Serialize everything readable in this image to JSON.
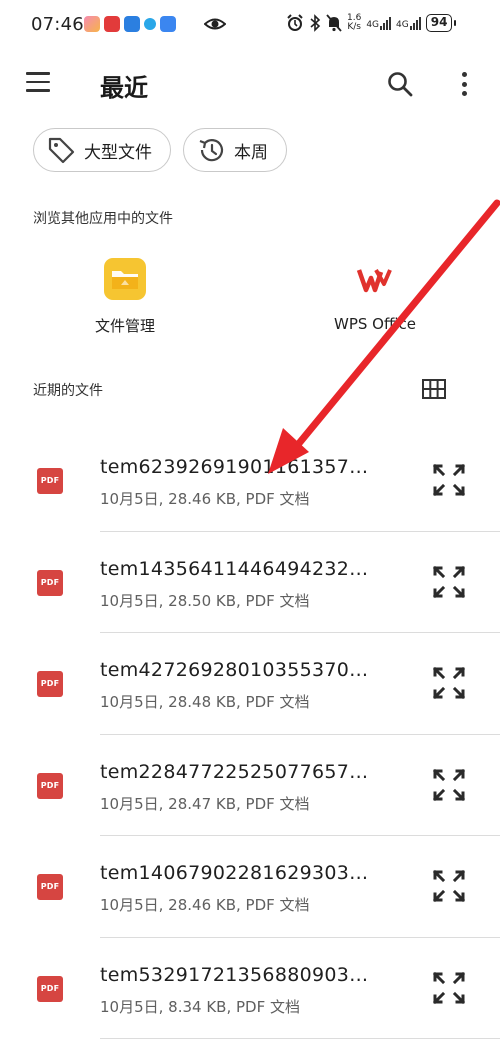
{
  "status_bar": {
    "time": "07:46",
    "net_speed_value": "1.6",
    "net_speed_unit": "K/s",
    "network_1": "4G",
    "network_2": "4G",
    "battery": "94"
  },
  "app_bar": {
    "title": "最近",
    "menu_icon": "hamburger-menu-icon",
    "search_icon": "search-icon",
    "more_icon": "more-vert-icon"
  },
  "chips": [
    {
      "label": "大型文件",
      "icon": "tag-icon"
    },
    {
      "label": "本周",
      "icon": "history-icon"
    }
  ],
  "other_apps": {
    "heading": "浏览其他应用中的文件",
    "items": [
      {
        "label": "文件管理",
        "icon": "folder-app-icon"
      },
      {
        "label": "WPS Office",
        "icon": "wps-office-icon"
      }
    ]
  },
  "recent_files": {
    "heading": "近期的文件",
    "view_toggle_icon": "grid-view-icon",
    "file_type_badge": "PDF",
    "items": [
      {
        "name": "tem62392691901161357…",
        "meta": "10月5日, 28.46 KB, PDF 文档"
      },
      {
        "name": "tem14356411446494232…",
        "meta": "10月5日, 28.50 KB, PDF 文档"
      },
      {
        "name": "tem42726928010355370…",
        "meta": "10月5日, 28.48 KB, PDF 文档"
      },
      {
        "name": "tem22847722525077657…",
        "meta": "10月5日, 28.47 KB, PDF 文档"
      },
      {
        "name": "tem14067902281629303…",
        "meta": "10月5日, 28.46 KB, PDF 文档"
      },
      {
        "name": "tem53291721356880903…",
        "meta": "10月5日, 8.34 KB, PDF 文档"
      }
    ]
  },
  "colors": {
    "pdf_red": "#d64541",
    "annotation_red": "#e8262a",
    "wps_red": "#e0322d",
    "folder_yellow": "#f6c531"
  }
}
